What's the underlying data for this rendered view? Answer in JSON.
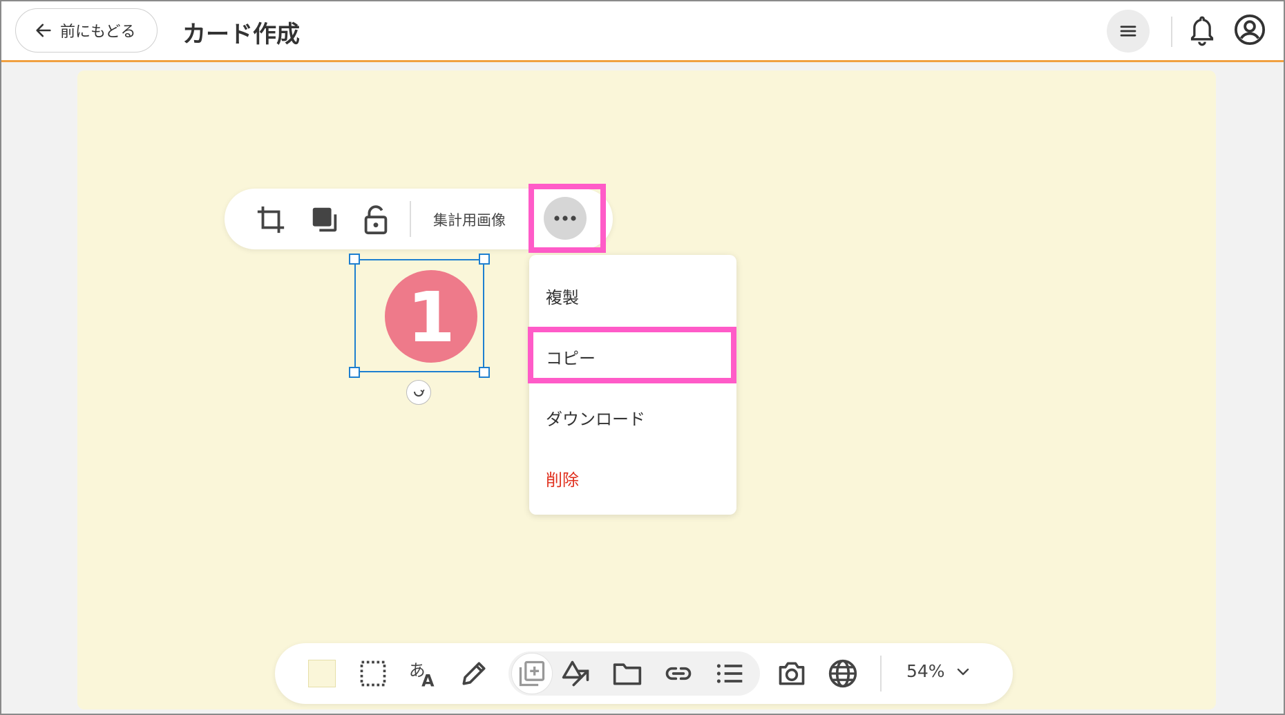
{
  "header": {
    "back_label": "前にもどる",
    "title": "カード作成"
  },
  "object_toolbar": {
    "label": "集計用画像",
    "icons": [
      "crop-icon",
      "layer-order-icon",
      "unlock-icon",
      "more-icon"
    ]
  },
  "context_menu": {
    "items": [
      {
        "label": "複製"
      },
      {
        "label": "コピー"
      },
      {
        "label": "ダウンロード"
      },
      {
        "label": "削除"
      }
    ]
  },
  "selected_image": {
    "text": "1",
    "color": "#ee7a8a"
  },
  "bottom_toolbar": {
    "zoom": "54%",
    "icons": [
      "background-color-swatch",
      "selection-icon",
      "text-icon",
      "pen-icon",
      "add-card-icon",
      "shape-icon",
      "folder-icon",
      "link-icon",
      "list-icon",
      "camera-icon",
      "globe-icon"
    ]
  },
  "colors": {
    "accent": "#f0a040",
    "highlight": "#ff5bc8",
    "selection": "#1d7fd0",
    "canvas": "#faf6d9",
    "danger": "#e0301e"
  }
}
